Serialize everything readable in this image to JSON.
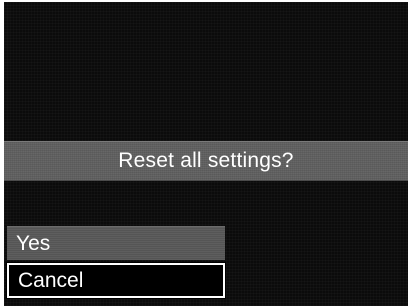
{
  "dialog": {
    "prompt": "Reset all settings?",
    "options": [
      {
        "label": "Yes",
        "selected": false
      },
      {
        "label": "Cancel",
        "selected": true
      }
    ]
  }
}
